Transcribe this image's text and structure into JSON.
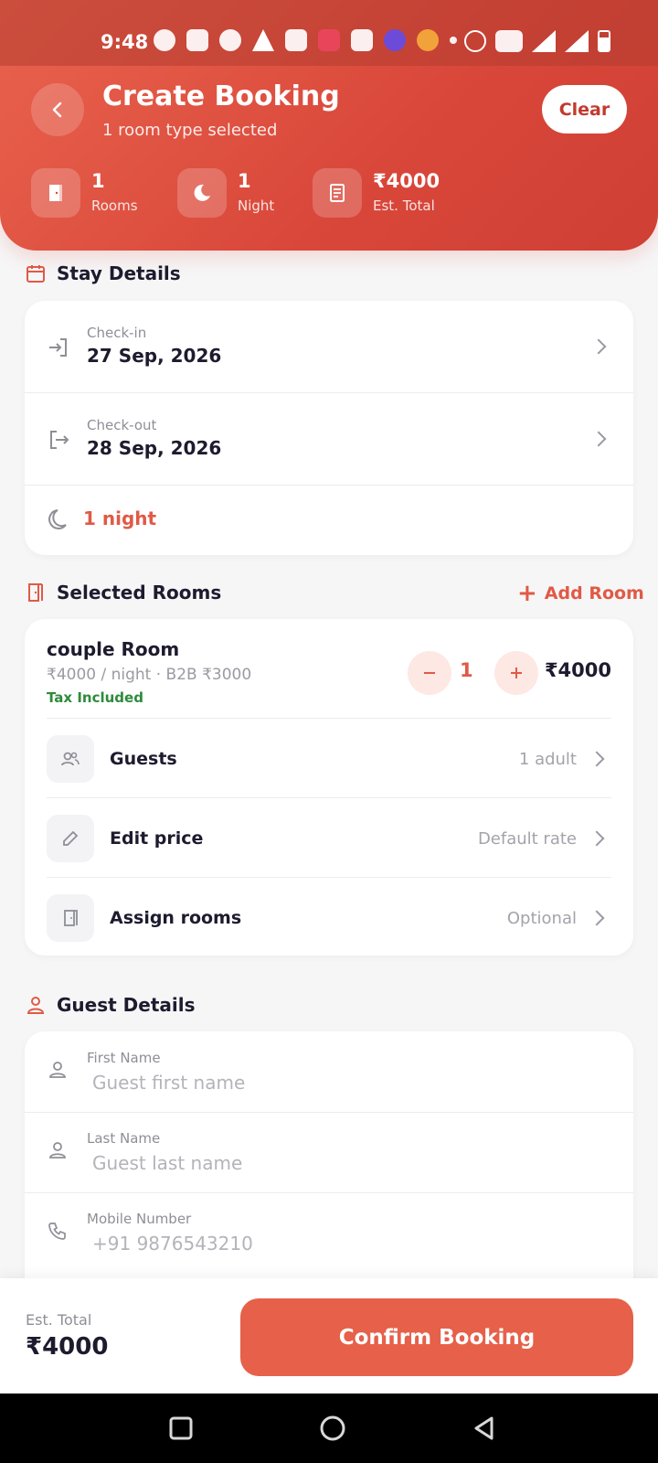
{
  "status_bar": {
    "time": "9:48"
  },
  "header": {
    "title": "Create Booking",
    "subtitle": "1 room type selected",
    "clear_label": "Clear",
    "stats": [
      {
        "value": "1",
        "label": "Rooms",
        "icon": "door-icon"
      },
      {
        "value": "1",
        "label": "Night",
        "icon": "moon-icon"
      },
      {
        "value": "₹4000",
        "label": "Est. Total",
        "icon": "receipt-icon"
      }
    ]
  },
  "stay": {
    "section_title": "Stay Details",
    "checkin_label": "Check-in",
    "checkin_value": "27 Sep, 2026",
    "checkout_label": "Check-out",
    "checkout_value": "28 Sep, 2026",
    "nights": "1 night"
  },
  "rooms": {
    "section_title": "Selected Rooms",
    "add_label": "Add Room",
    "items": [
      {
        "name": "couple Room",
        "rate": "₹4000 / night · B2B ₹3000",
        "tax": "Tax Included",
        "qty": "1",
        "price": "₹4000"
      }
    ],
    "options": [
      {
        "label": "Guests",
        "value": "1 adult"
      },
      {
        "label": "Edit price",
        "value": "Default rate"
      },
      {
        "label": "Assign rooms",
        "value": "Optional"
      }
    ]
  },
  "guest": {
    "section_title": "Guest Details",
    "fields": [
      {
        "label": "First Name",
        "placeholder": "Guest first name"
      },
      {
        "label": "Last Name",
        "placeholder": "Guest last name"
      },
      {
        "label": "Mobile Number",
        "placeholder": "+91 9876543210"
      }
    ]
  },
  "footer": {
    "total_label": "Est. Total",
    "total_value": "₹4000",
    "confirm_label": "Confirm Booking"
  },
  "colors": {
    "accent": "#e6604a",
    "header": "#d9473a",
    "tax": "#2f8a3c"
  }
}
